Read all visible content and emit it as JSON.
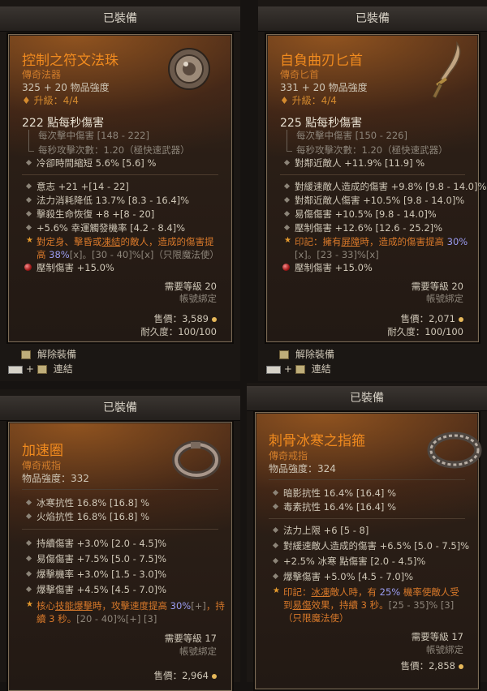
{
  "header_label": "已裝備",
  "items": [
    {
      "name": "控制之符文法珠",
      "type": "傳奇法器",
      "power": "325 + 20 物品強度",
      "upgrade": "升級：4/4",
      "dps": "222 點每秒傷害",
      "sub1": "每次擊中傷害 [148 - 222]",
      "sub2": "每秒攻擊次數：1.20（極快速武器）",
      "stat_cd": "冷卻時間縮短 5.6% [5.6] %",
      "affixes": [
        "意志 +21 +[14 - 22]",
        "法力消耗降低 13.7% [8.3 - 16.4]%",
        "擊殺生命恢復 +8 +[8 - 20]",
        "+5.6% 幸運觸發機率 [4.2 - 8.4]%"
      ],
      "aspect": {
        "p1": "對定身、擊昏或",
        "k1": "凍結",
        "p2": "的敵人，造成的傷害提",
        "p3": "高 ",
        "val": "38%",
        "p4": "[x]。[30 - 40]%[x]（只限魔法使）"
      },
      "gem": "壓制傷害 +15.0%",
      "req": "需要等級 20",
      "bind": "帳號綁定",
      "sell": "售價：3,589",
      "durability": "耐久度：100/100"
    },
    {
      "name": "自負曲刃匕首",
      "type": "傳奇匕首",
      "power": "331 + 20 物品強度",
      "upgrade": "升級：4/4",
      "dps": "225 點每秒傷害",
      "sub1": "每次擊中傷害 [150 - 226]",
      "sub2": "每秒攻擊次數：1.20（極快速武器）",
      "stat_cd": "對鄰近敵人 +11.9% [11.9] %",
      "affixes": [
        "對緩速敵人造成的傷害 +9.8% [9.8 - 14.0]%",
        "對鄰近敵人傷害 +10.5% [9.8 - 14.0]%",
        "易傷傷害 +10.5% [9.8 - 14.0]%",
        "壓制傷害 +12.6% [12.6 - 25.2]%"
      ],
      "aspect": {
        "p1": "印記：擁有",
        "k1": "屏障",
        "p2": "時，造成的傷害提高 ",
        "val": "30%",
        "p3": "[x]。[23 - 33]%[x]"
      },
      "gem": "壓制傷害 +15.0%",
      "req": "需要等級 20",
      "bind": "帳號綁定",
      "sell": "售價：2,071",
      "durability": "耐久度：100/100"
    },
    {
      "name": "加速圈",
      "type": "傳奇戒指",
      "power": "物品強度：332",
      "res": [
        "冰寒抗性 16.8% [16.8] %",
        "火焰抗性 16.8% [16.8] %"
      ],
      "affixes": [
        "持續傷害 +3.0% [2.0 - 4.5]%",
        "易傷傷害 +7.5% [5.0 - 7.5]%",
        "爆擊機率 +3.0% [1.5 - 3.0]%",
        "爆擊傷害 +4.5% [4.5 - 7.0]%"
      ],
      "aspect": {
        "p1": "核心",
        "k1": "技能爆擊",
        "p2": "時，攻擊速度提高 ",
        "val": "30%",
        "p3": "[+]，持",
        "p4": "續 3 秒。[20 - 40]%[+] [3]"
      },
      "req": "需要等級 17",
      "bind": "帳號綁定",
      "sell": "售價：2,964"
    },
    {
      "name": "刺骨冰寒之指箍",
      "type": "傳奇戒指",
      "power": "物品強度：324",
      "res": [
        "暗影抗性 16.4% [16.4] %",
        "毒素抗性 16.4% [16.4] %"
      ],
      "affixes": [
        "法力上限 +6 [5 - 8]",
        "對緩速敵人造成的傷害 +6.5% [5.0 - 7.5]%",
        "+2.5% 冰寒 點傷害 [2.0 - 4.5]%",
        "爆擊傷害 +5.0% [4.5 - 7.0]%"
      ],
      "aspect": {
        "p1": "印記：",
        "k1": "冰凍",
        "p2": "敵人時，有 ",
        "val": "25%",
        "p3": " 機率使敵人受",
        "p4a": "到",
        "k2": "易傷",
        "p4b": "效果，持續 3 秒。[25 - 35]% [3]",
        "p5": "（只限魔法使）"
      },
      "req": "需要等級 17",
      "bind": "帳號綁定",
      "sell": "售價：2,858"
    }
  ],
  "actions": {
    "unequip": "解除裝備",
    "plus": "+",
    "link": "連結"
  }
}
